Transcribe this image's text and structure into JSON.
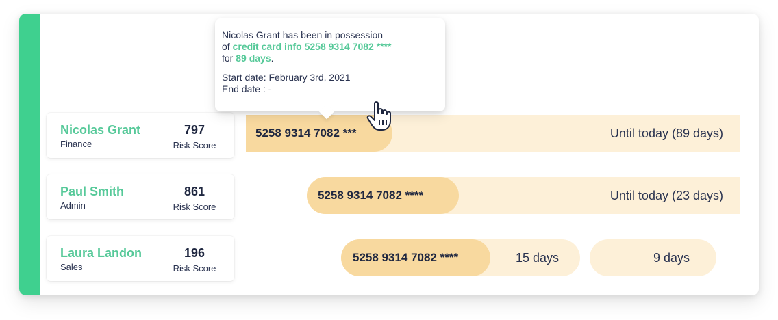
{
  "people": [
    {
      "name": "Nicolas Grant",
      "department": "Finance",
      "score": "797",
      "score_label": "Risk Score"
    },
    {
      "name": "Paul Smith",
      "department": "Admin",
      "score": "861",
      "score_label": "Risk Score"
    },
    {
      "name": "Laura Landon",
      "department": "Sales",
      "score": "196",
      "score_label": "Risk Score"
    }
  ],
  "timelines": [
    {
      "card_label": "5258 9314 7082 ***",
      "duration_label": "Until today (89 days)"
    },
    {
      "card_label": "5258 9314 7082 ****",
      "duration_label": "Until today (23 days)"
    },
    {
      "card_label": "5258 9314 7082 ****",
      "duration_label": "15 days",
      "second_duration_label": "9 days"
    }
  ],
  "tooltip": {
    "line1": "Nicolas Grant has been in possession",
    "of_prefix": "of ",
    "credential": "credit card info 5258 9314 7082 ****",
    "for_prefix": "for ",
    "days": "89 days",
    "period": ".",
    "start_date": "Start date: February 3rd, 2021",
    "end_date": "End date : -"
  },
  "colors": {
    "accent": "#3fd08f",
    "name_green": "#56c999",
    "track": "#fdf0d8",
    "pill": "#f8d99f"
  },
  "icons": {
    "cursor": "hand-pointer-icon"
  }
}
